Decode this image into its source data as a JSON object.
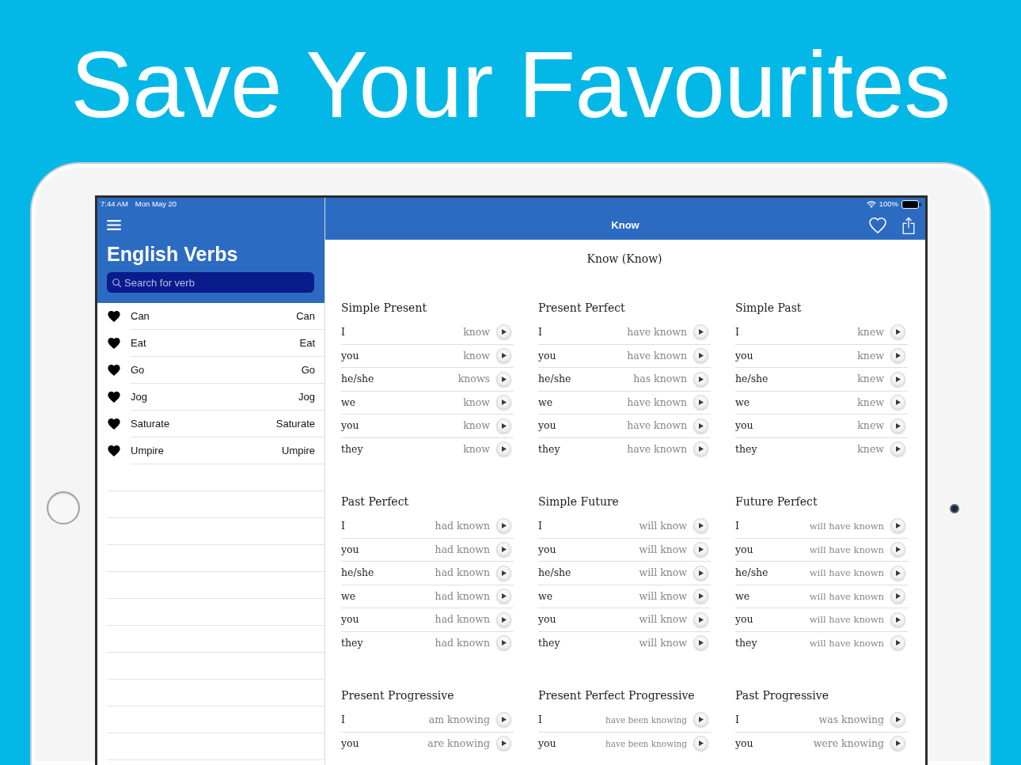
{
  "headline": "Save Your Favourites",
  "status_bar": {
    "time": "7:44 AM",
    "date": "Mon May 20",
    "battery": "100%"
  },
  "sidebar": {
    "title": "English Verbs",
    "search": {
      "placeholder": "Search for verb"
    },
    "items": [
      {
        "name": "Can",
        "detail": "Can",
        "favourite": true
      },
      {
        "name": "Eat",
        "detail": "Eat",
        "favourite": true
      },
      {
        "name": "Go",
        "detail": "Go",
        "favourite": true
      },
      {
        "name": "Jog",
        "detail": "Jog",
        "favourite": true
      },
      {
        "name": "Saturate",
        "detail": "Saturate",
        "favourite": true
      },
      {
        "name": "Umpire",
        "detail": "Umpire",
        "favourite": true
      }
    ]
  },
  "nav_bar": {
    "title": "Know",
    "favourite": false
  },
  "content": {
    "title": "Know (Know)",
    "tenses": [
      {
        "name": "Simple Present",
        "rows": [
          {
            "pronoun": "I",
            "form": "know"
          },
          {
            "pronoun": "you",
            "form": "know"
          },
          {
            "pronoun": "he/she",
            "form": "knows"
          },
          {
            "pronoun": "we",
            "form": "know"
          },
          {
            "pronoun": "you",
            "form": "know"
          },
          {
            "pronoun": "they",
            "form": "know"
          }
        ]
      },
      {
        "name": "Present Perfect",
        "rows": [
          {
            "pronoun": "I",
            "form": "have known"
          },
          {
            "pronoun": "you",
            "form": "have known"
          },
          {
            "pronoun": "he/she",
            "form": "has known"
          },
          {
            "pronoun": "we",
            "form": "have known"
          },
          {
            "pronoun": "you",
            "form": "have known"
          },
          {
            "pronoun": "they",
            "form": "have known"
          }
        ]
      },
      {
        "name": "Simple Past",
        "rows": [
          {
            "pronoun": "I",
            "form": "knew"
          },
          {
            "pronoun": "you",
            "form": "knew"
          },
          {
            "pronoun": "he/she",
            "form": "knew"
          },
          {
            "pronoun": "we",
            "form": "knew"
          },
          {
            "pronoun": "you",
            "form": "knew"
          },
          {
            "pronoun": "they",
            "form": "knew"
          }
        ]
      },
      {
        "name": "Past Perfect",
        "rows": [
          {
            "pronoun": "I",
            "form": "had known"
          },
          {
            "pronoun": "you",
            "form": "had known"
          },
          {
            "pronoun": "he/she",
            "form": "had known"
          },
          {
            "pronoun": "we",
            "form": "had known"
          },
          {
            "pronoun": "you",
            "form": "had known"
          },
          {
            "pronoun": "they",
            "form": "had known"
          }
        ]
      },
      {
        "name": "Simple Future",
        "rows": [
          {
            "pronoun": "I",
            "form": "will know"
          },
          {
            "pronoun": "you",
            "form": "will know"
          },
          {
            "pronoun": "he/she",
            "form": "will know"
          },
          {
            "pronoun": "we",
            "form": "will know"
          },
          {
            "pronoun": "you",
            "form": "will know"
          },
          {
            "pronoun": "they",
            "form": "will know"
          }
        ]
      },
      {
        "name": "Future Perfect",
        "rows": [
          {
            "pronoun": "I",
            "form": "will have known"
          },
          {
            "pronoun": "you",
            "form": "will have known"
          },
          {
            "pronoun": "he/she",
            "form": "will have known"
          },
          {
            "pronoun": "we",
            "form": "will have known"
          },
          {
            "pronoun": "you",
            "form": "will have known"
          },
          {
            "pronoun": "they",
            "form": "will have known"
          }
        ]
      },
      {
        "name": "Present Progressive",
        "rows": [
          {
            "pronoun": "I",
            "form": "am knowing"
          },
          {
            "pronoun": "you",
            "form": "are knowing"
          }
        ]
      },
      {
        "name": "Present Perfect Progressive",
        "rows": [
          {
            "pronoun": "I",
            "form": "have been knowing"
          },
          {
            "pronoun": "you",
            "form": "have been knowing"
          }
        ]
      },
      {
        "name": "Past Progressive",
        "rows": [
          {
            "pronoun": "I",
            "form": "was knowing"
          },
          {
            "pronoun": "you",
            "form": "were knowing"
          }
        ]
      }
    ]
  }
}
